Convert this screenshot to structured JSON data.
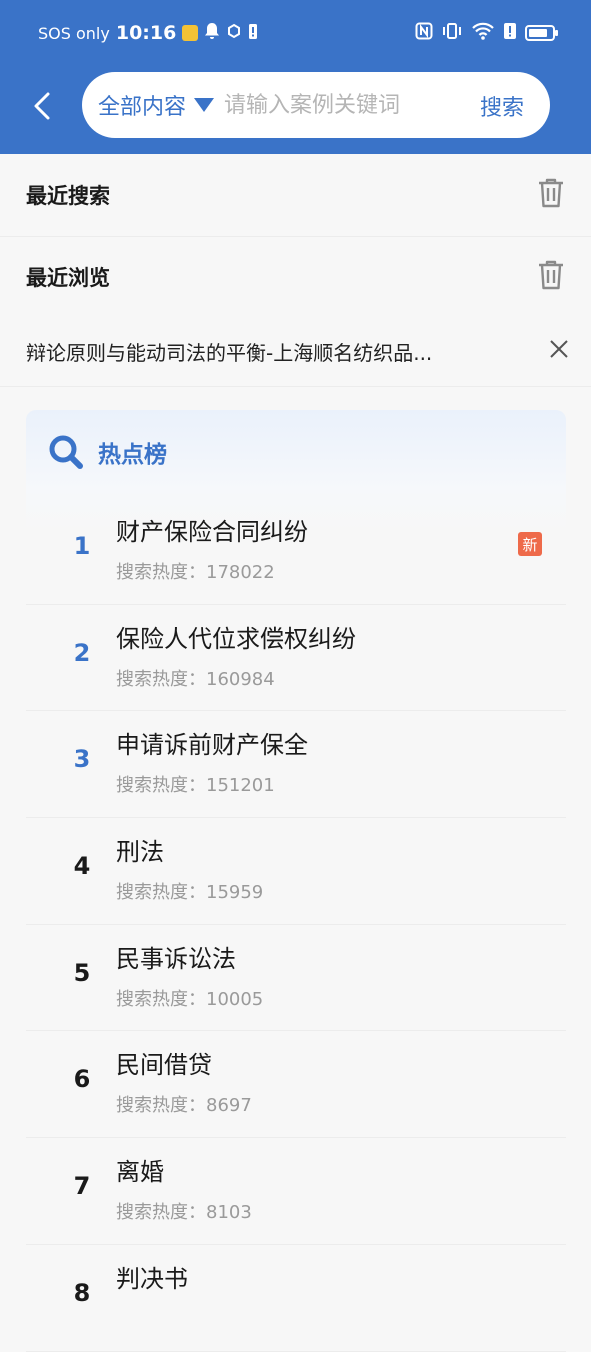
{
  "status_bar": {
    "carrier": "SOS only",
    "time": "10:16"
  },
  "search": {
    "scope": "全部内容",
    "placeholder": "请输入案例关键词",
    "submit_label": "搜索"
  },
  "recent_search": {
    "title": "最近搜索"
  },
  "recent_browse": {
    "title": "最近浏览",
    "items": [
      {
        "text": "辩论原则与能动司法的平衡-上海顺名纺织品..."
      }
    ]
  },
  "hot_list": {
    "title": "热点榜",
    "heat_prefix": "搜索热度：",
    "items": [
      {
        "rank": "1",
        "name": "财产保险合同纠纷",
        "heat": "搜索热度：178022",
        "badge": "新"
      },
      {
        "rank": "2",
        "name": "保险人代位求偿权纠纷",
        "heat": "搜索热度：160984"
      },
      {
        "rank": "3",
        "name": "申请诉前财产保全",
        "heat": "搜索热度：151201"
      },
      {
        "rank": "4",
        "name": "刑法",
        "heat": "搜索热度：15959"
      },
      {
        "rank": "5",
        "name": "民事诉讼法",
        "heat": "搜索热度：10005"
      },
      {
        "rank": "6",
        "name": "民间借贷",
        "heat": "搜索热度：8697"
      },
      {
        "rank": "7",
        "name": "离婚",
        "heat": "搜索热度：8103"
      },
      {
        "rank": "8",
        "name": "判决书",
        "heat": ""
      }
    ]
  },
  "colors": {
    "primary": "#3a73c8",
    "badge": "#ee6a4a"
  }
}
